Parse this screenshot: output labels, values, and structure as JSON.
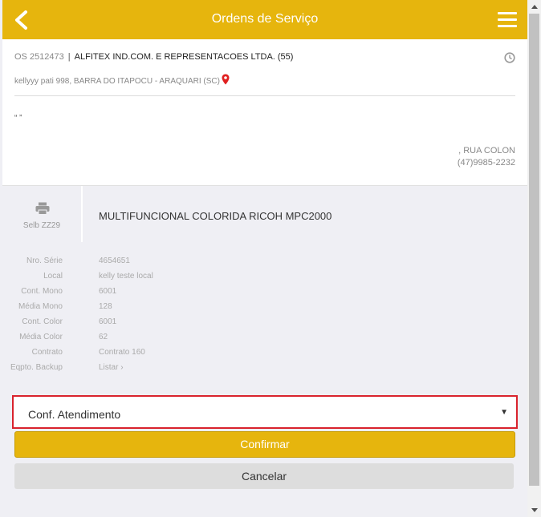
{
  "header": {
    "title": "Ordens de Serviço"
  },
  "order": {
    "os_number": "OS 2512473",
    "separator": "|",
    "company": "ALFITEX IND.COM. E REPRESENTACOES LTDA. (55)",
    "address": "kellyyy pati 998, BARRA DO ITAPOCU - ARAQUARI (SC)",
    "quote": "“ ”",
    "street": ", RUA COLON",
    "phone": "(47)9985-2232"
  },
  "equipment": {
    "code": "Selb ZZ29",
    "model": "MULTIFUNCIONAL COLORIDA RICOH MPC2000"
  },
  "fields": [
    {
      "label": "Nro. Série",
      "value": "4654651"
    },
    {
      "label": "Local",
      "value": "kelly teste local"
    },
    {
      "label": "Cont. Mono",
      "value": "6001"
    },
    {
      "label": "Média Mono",
      "value": "128"
    },
    {
      "label": "Cont. Color",
      "value": "6001"
    },
    {
      "label": "Média Color",
      "value": "62"
    },
    {
      "label": "Contrato",
      "value": "Contrato 160"
    },
    {
      "label": "Eqpto. Backup",
      "value": "Listar ›"
    }
  ],
  "form": {
    "select_value": "Conf. Atendimento",
    "confirm_label": "Confirmar",
    "cancel_label": "Cancelar"
  },
  "colors": {
    "accent": "#e6b50d",
    "highlight": "#d9232d",
    "pin": "#e02020"
  }
}
